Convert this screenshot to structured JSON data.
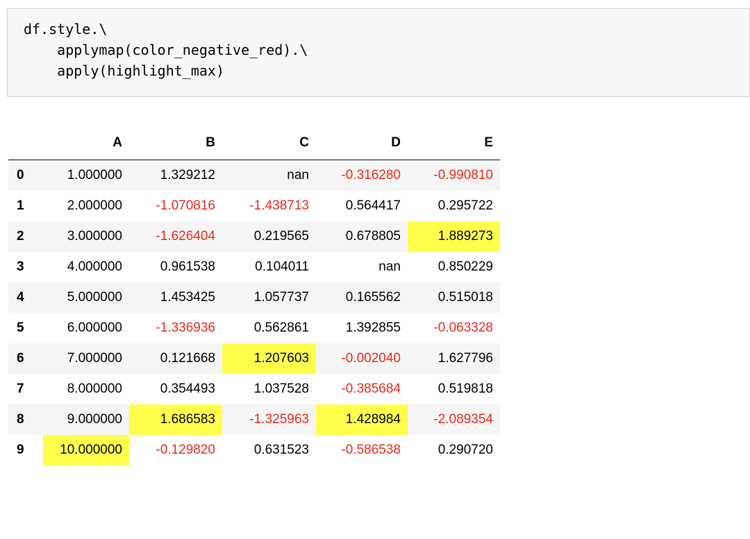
{
  "code_cell": {
    "lines": [
      "df.style.\\",
      "    applymap(color_negative_red).\\",
      "    apply(highlight_max)"
    ]
  },
  "table": {
    "columns": [
      "",
      "A",
      "B",
      "C",
      "D",
      "E"
    ],
    "rows": [
      {
        "index": "0",
        "cells": [
          "1.000000",
          "1.329212",
          "nan",
          "-0.316280",
          "-0.990810"
        ],
        "highlight": [
          false,
          false,
          false,
          false,
          false
        ]
      },
      {
        "index": "1",
        "cells": [
          "2.000000",
          "-1.070816",
          "-1.438713",
          "0.564417",
          "0.295722"
        ],
        "highlight": [
          false,
          false,
          false,
          false,
          false
        ]
      },
      {
        "index": "2",
        "cells": [
          "3.000000",
          "-1.626404",
          "0.219565",
          "0.678805",
          "1.889273"
        ],
        "highlight": [
          false,
          false,
          false,
          false,
          true
        ]
      },
      {
        "index": "3",
        "cells": [
          "4.000000",
          "0.961538",
          "0.104011",
          "nan",
          "0.850229"
        ],
        "highlight": [
          false,
          false,
          false,
          false,
          false
        ]
      },
      {
        "index": "4",
        "cells": [
          "5.000000",
          "1.453425",
          "1.057737",
          "0.165562",
          "0.515018"
        ],
        "highlight": [
          false,
          false,
          false,
          false,
          false
        ]
      },
      {
        "index": "5",
        "cells": [
          "6.000000",
          "-1.336936",
          "0.562861",
          "1.392855",
          "-0.063328"
        ],
        "highlight": [
          false,
          false,
          false,
          false,
          false
        ]
      },
      {
        "index": "6",
        "cells": [
          "7.000000",
          "0.121668",
          "1.207603",
          "-0.002040",
          "1.627796"
        ],
        "highlight": [
          false,
          false,
          true,
          false,
          false
        ]
      },
      {
        "index": "7",
        "cells": [
          "8.000000",
          "0.354493",
          "1.037528",
          "-0.385684",
          "0.519818"
        ],
        "highlight": [
          false,
          false,
          false,
          false,
          false
        ]
      },
      {
        "index": "8",
        "cells": [
          "9.000000",
          "1.686583",
          "-1.325963",
          "1.428984",
          "-2.089354"
        ],
        "highlight": [
          false,
          true,
          false,
          true,
          false
        ]
      },
      {
        "index": "9",
        "cells": [
          "10.000000",
          "-0.129820",
          "0.631523",
          "-0.586538",
          "0.290720"
        ],
        "highlight": [
          true,
          false,
          false,
          false,
          false
        ]
      }
    ]
  },
  "colors": {
    "negative_text": "#e8291c",
    "highlight_bg": "#ffff4c",
    "stripe_bg": "#f5f5f5",
    "code_bg": "#f7f7f7"
  }
}
